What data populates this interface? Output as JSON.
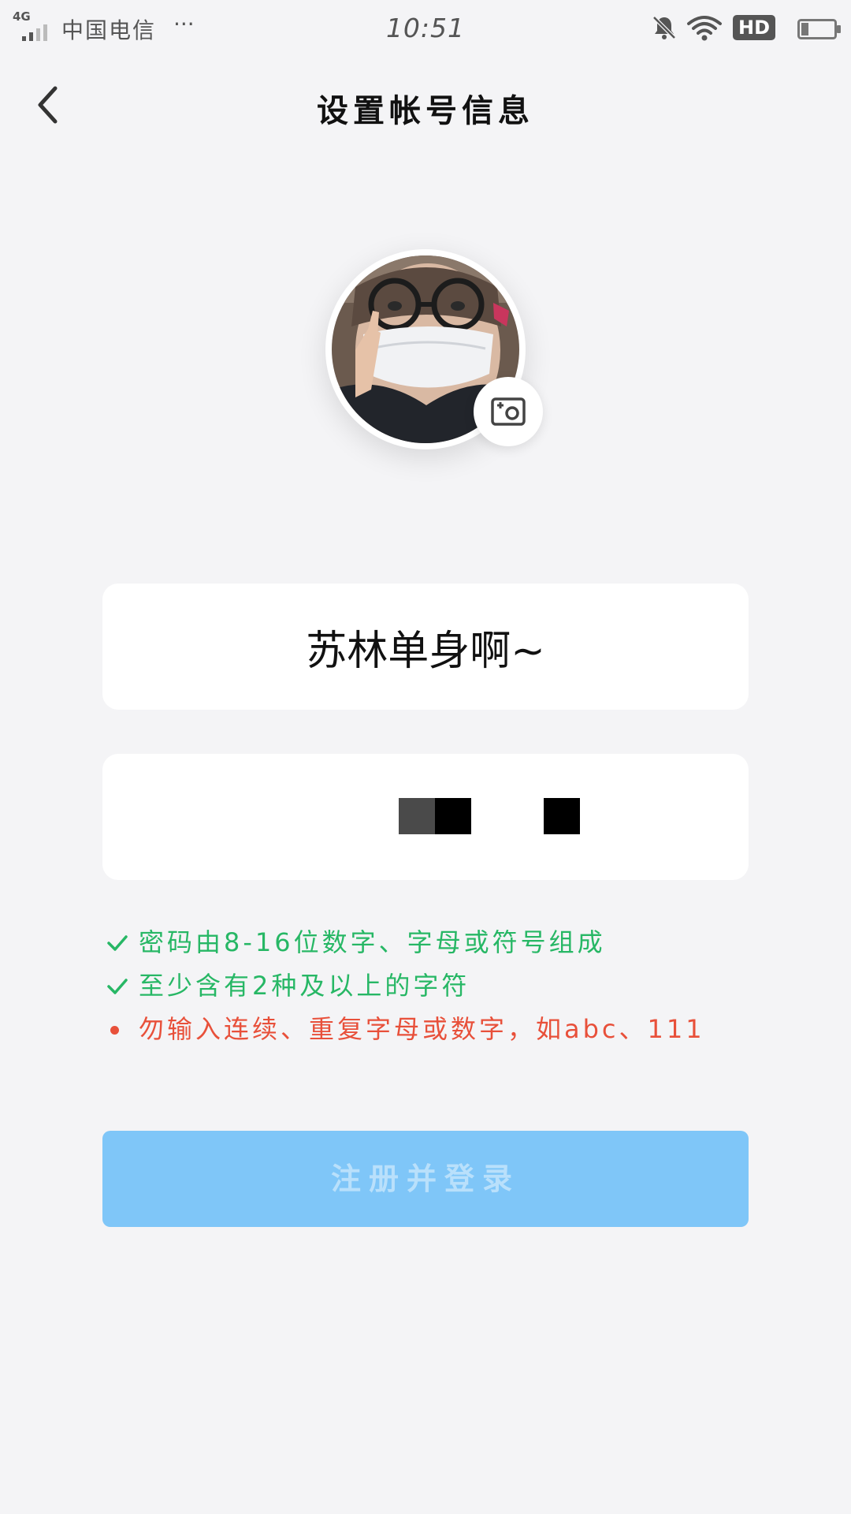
{
  "status_bar": {
    "network": "4G",
    "carrier": "中国电信",
    "more": "···",
    "time": "10:51",
    "hd_badge": "HD",
    "icons": [
      "signal-icon",
      "bell-muted-icon",
      "wifi-icon",
      "battery-icon"
    ]
  },
  "header": {
    "title": "设置帐号信息",
    "back_icon": "chevron-left-icon"
  },
  "avatar": {
    "camera_icon": "camera-add-icon"
  },
  "form": {
    "nickname_value": "苏林单身啊~"
  },
  "rules": [
    {
      "state": "ok",
      "icon": "check-icon",
      "text": "密码由8-16位数字、字母或符号组成"
    },
    {
      "state": "ok",
      "icon": "check-icon",
      "text": "至少含有2种及以上的字符"
    },
    {
      "state": "error",
      "icon": "dot-icon",
      "text": "勿输入连续、重复字母或数字，如abc、111"
    }
  ],
  "submit": {
    "label": "注册并登录"
  },
  "colors": {
    "background": "#f4f4f6",
    "ok": "#27b765",
    "error": "#e8503a",
    "button": "#7fc6f8",
    "button_text": "#b9e0fb"
  }
}
